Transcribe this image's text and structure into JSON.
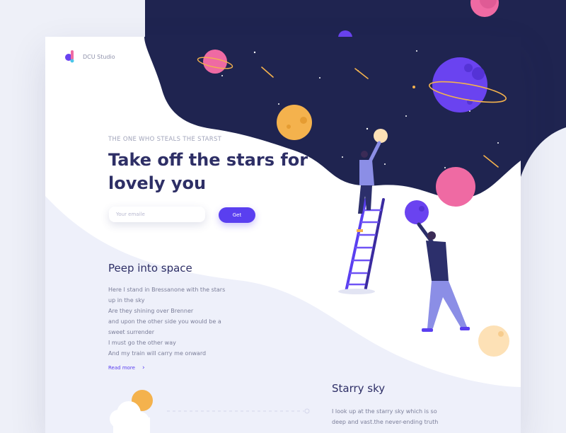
{
  "brand": {
    "name": "DCU Studio",
    "icon": "dcu-logo-icon"
  },
  "hero": {
    "kicker": "THE ONE WHO STEALS THE STARST",
    "title_line1": "Take off the stars for",
    "title_line2": "lovely you",
    "email_placeholder": "Your emaile",
    "email_value": "",
    "cta_label": "Get"
  },
  "peep": {
    "title": "Peep into space",
    "lines": [
      "Here I stand in Bressanone with the stars",
      "up in the sky",
      "Are they shining over Brenner",
      "and upon the other side you would be a",
      "sweet surrender",
      "I must go the other way",
      "And my train will carry me onward"
    ],
    "read_more": "Read more"
  },
  "starry": {
    "title": "Starry sky",
    "lines": [
      "I look up at the starry sky  which is so",
      "deep and vast.the never-ending truth"
    ]
  },
  "colors": {
    "night": "#1f2450",
    "accent": "#5a3ff0",
    "heading": "#2e2f66",
    "pink_planet": "#ef6aa3",
    "orange_planet": "#f4b24d",
    "purple_planet": "#6a43f0",
    "lavender": "#eef0fa"
  },
  "illustration": {
    "icons": [
      "ringed-planet-icon",
      "moon-icon",
      "star-icon",
      "shooting-star-icon",
      "cloud-sun-icon",
      "ladder-icon",
      "person-on-ladder",
      "person-holding-planet"
    ]
  }
}
